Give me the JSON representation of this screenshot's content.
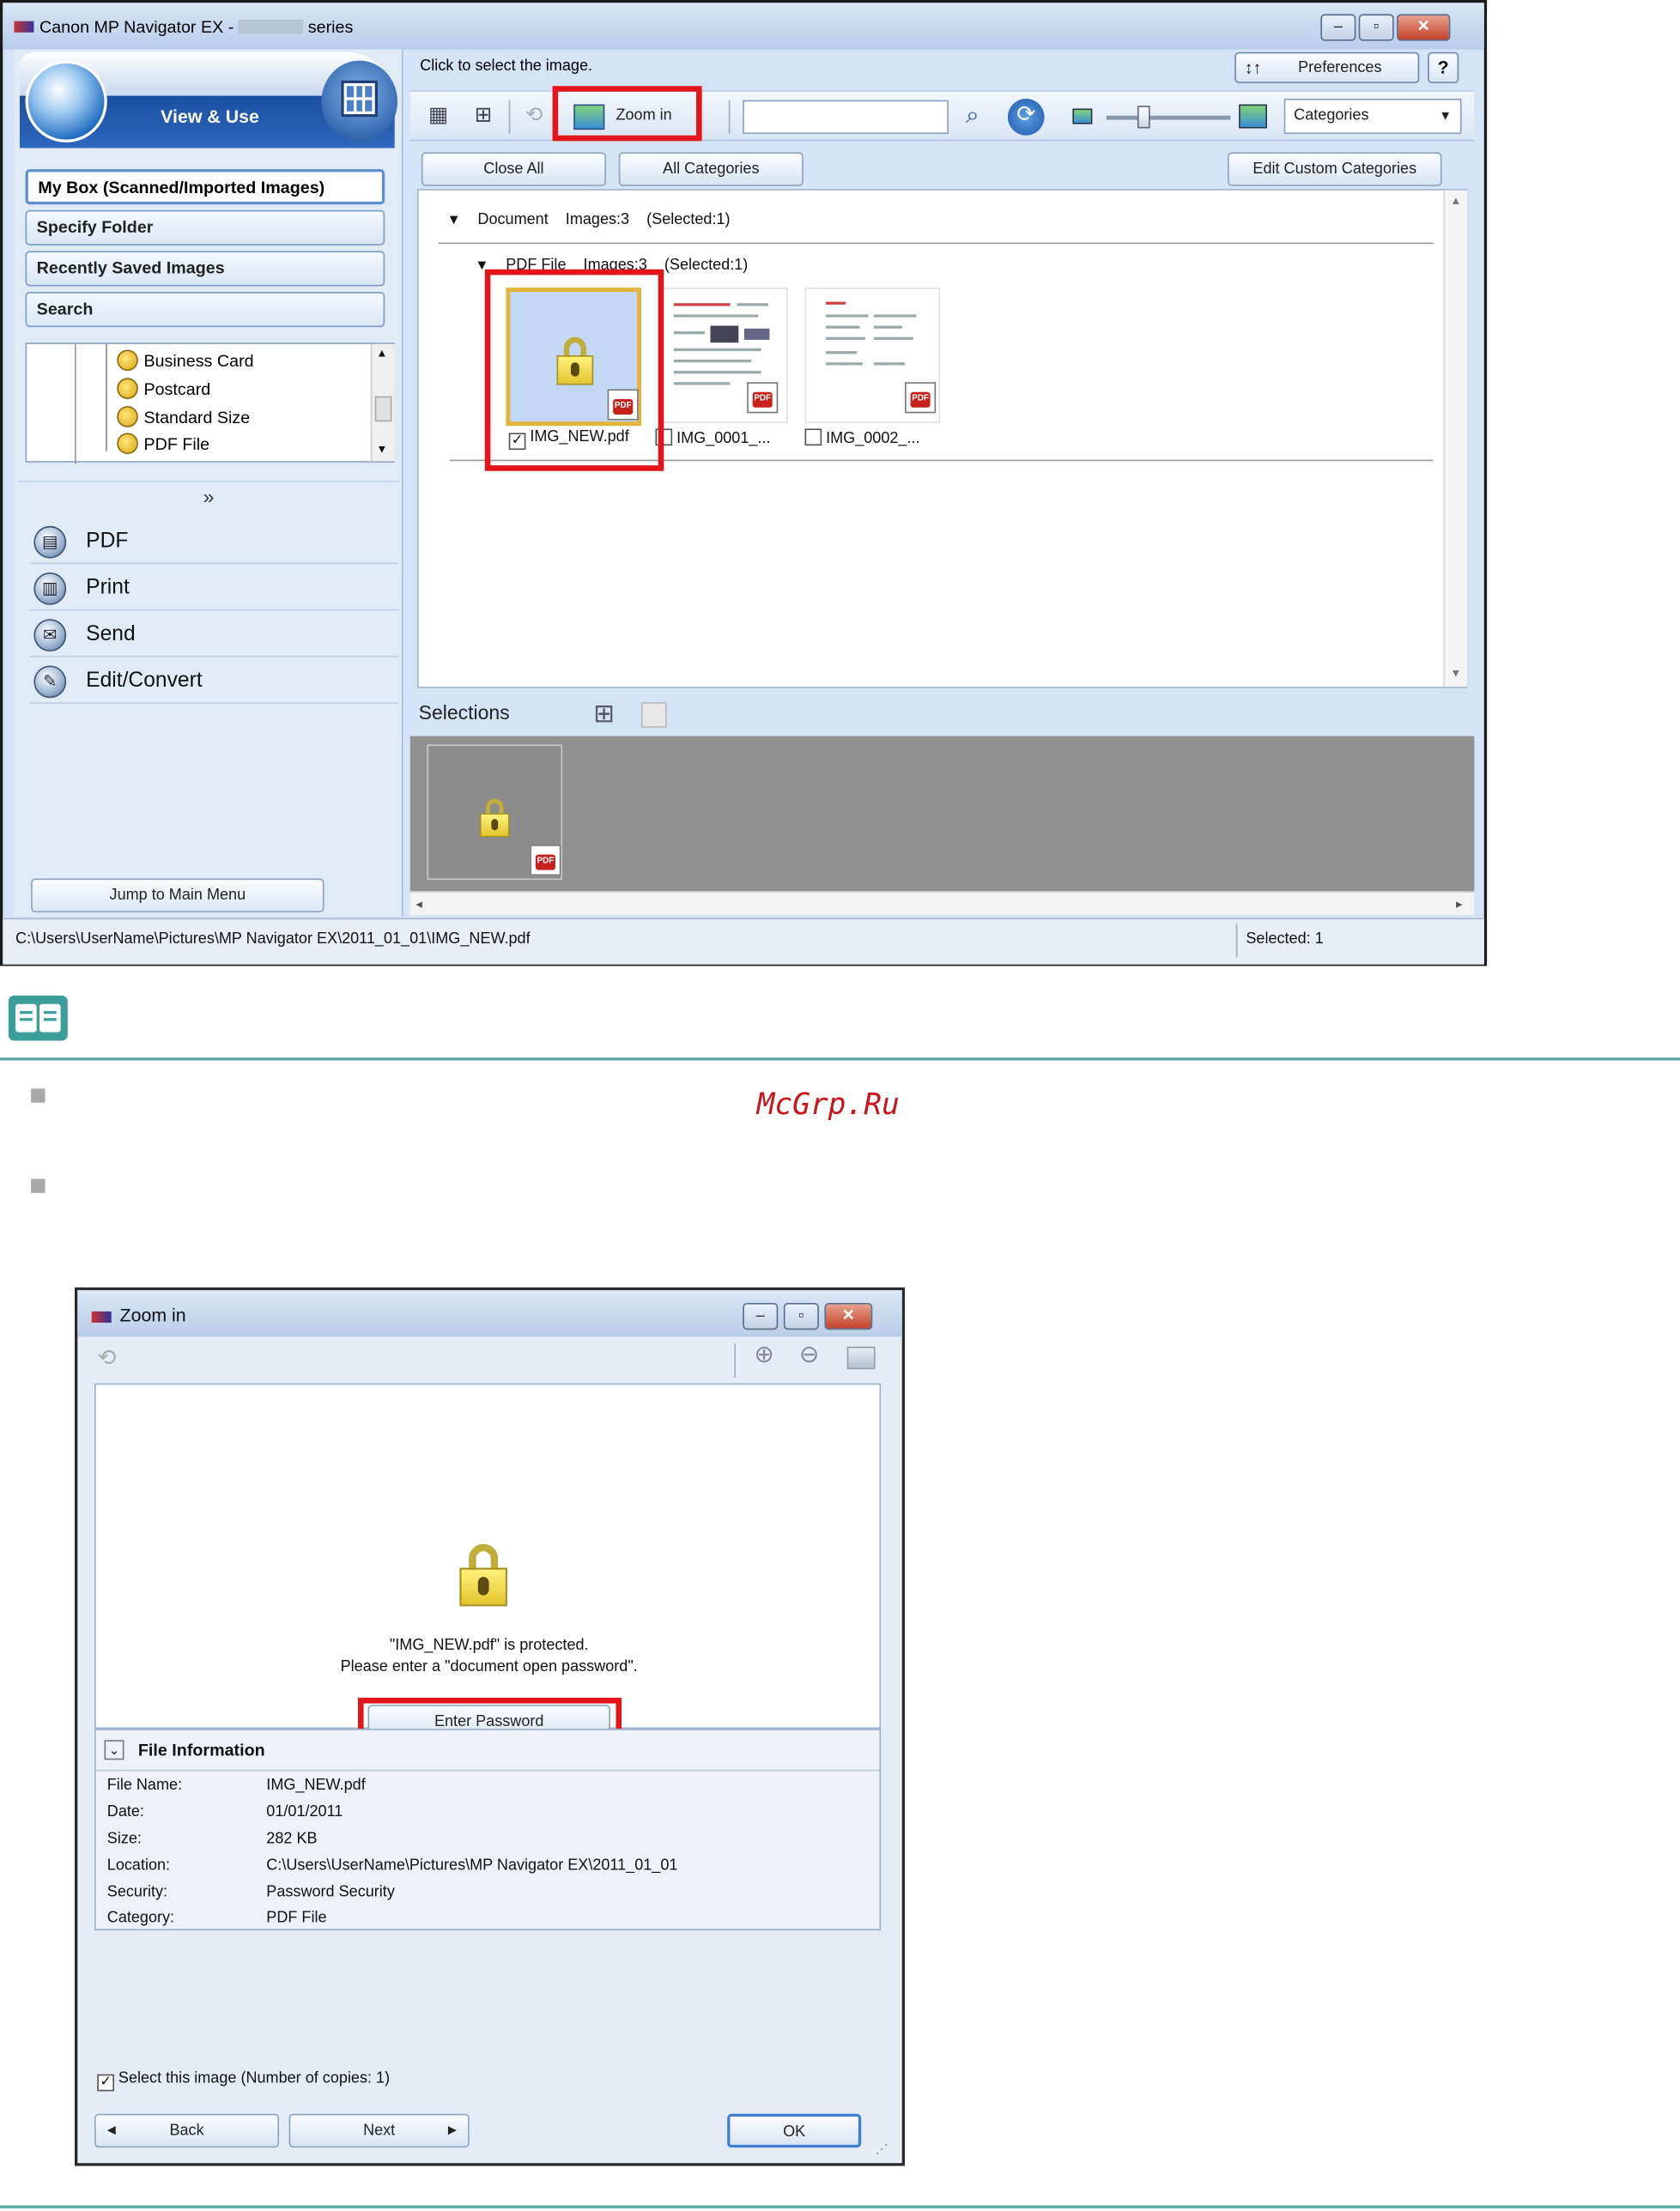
{
  "main_window": {
    "title": "Canon MP Navigator EX - ",
    "title_suffix": "series",
    "left_panel": {
      "header": "View & Use",
      "nav_buttons": [
        "My Box (Scanned/Imported Images)",
        "Specify Folder",
        "Recently Saved Images",
        "Search"
      ],
      "tree_items": [
        "Business Card",
        "Postcard",
        "Standard Size",
        "PDF File"
      ],
      "actions": [
        "PDF",
        "Print",
        "Send",
        "Edit/Convert"
      ],
      "jump_button": "Jump to Main Menu"
    },
    "right_panel": {
      "hint": "Click to select the image.",
      "preferences": "Preferences",
      "help": "?",
      "toolbar": {
        "zoom_in": "Zoom in",
        "search_value": "",
        "category_select": "Categories"
      },
      "buttons": {
        "close_all": "Close All",
        "all_categories": "All Categories",
        "edit_custom": "Edit Custom Categories"
      },
      "groups": {
        "document": "Document    Images:3    (Selected:1)",
        "pdf_file": "PDF File    Images:3    (Selected:1)"
      },
      "thumbnails": [
        {
          "label": "IMG_NEW.pdf",
          "checked": true
        },
        {
          "label": "IMG_0001_...",
          "checked": false
        },
        {
          "label": "IMG_0002_...",
          "checked": false
        }
      ],
      "selections_title": "Selections"
    },
    "status": {
      "path": "C:\\Users\\UserName\\Pictures\\MP Navigator EX\\2011_01_01\\IMG_NEW.pdf",
      "selected": "Selected: 1"
    }
  },
  "note": {
    "watermark": "McGrp.Ru"
  },
  "zoom_dialog": {
    "title": "Zoom in",
    "message_line1": "\"IMG_NEW.pdf\" is protected.",
    "message_line2": "Please enter a \"document open password\".",
    "enter_password": "Enter Password",
    "file_info_title": "File Information",
    "file_info": [
      {
        "key": "File Name:",
        "value": "IMG_NEW.pdf"
      },
      {
        "key": "Date:",
        "value": "01/01/2011"
      },
      {
        "key": "Size:",
        "value": "282 KB"
      },
      {
        "key": "Location:",
        "value": "C:\\Users\\UserName\\Pictures\\MP Navigator EX\\2011_01_01"
      },
      {
        "key": "Security:",
        "value": "Password Security"
      },
      {
        "key": "Category:",
        "value": "PDF File"
      }
    ],
    "select_image": "Select this image (Number of copies: 1)",
    "back": "Back",
    "next": "Next",
    "ok": "OK"
  },
  "colors": {
    "highlight_red": "#e3141a",
    "accent_teal": "#3c9e98",
    "titlebar_blue": "#b7cde8"
  }
}
